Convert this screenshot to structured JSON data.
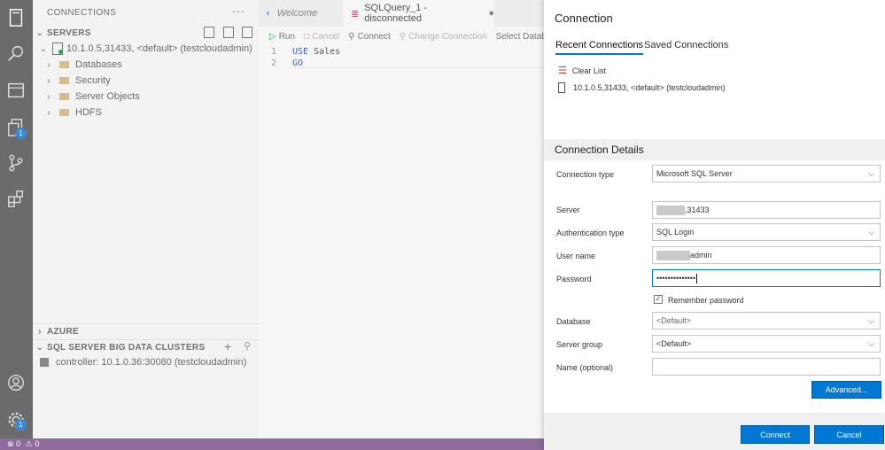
{
  "sidebar": {
    "title": "CONNECTIONS",
    "more": "···",
    "servers_header": "SERVERS",
    "server_node": "10.1.0.5,31433, <default> (testcloudadmin)",
    "children": [
      "Databases",
      "Security",
      "Server Objects",
      "HDFS"
    ],
    "azure_header": "AZURE",
    "bdc_header": "SQL SERVER BIG DATA CLUSTERS",
    "bdc_item": "controller: 10.1.0.36:30080 (testcloudadmin)"
  },
  "activity": {
    "explorer_badge": "1",
    "settings_badge": "1"
  },
  "editor": {
    "tab_welcome": "Welcome",
    "tab_query": "SQLQuery_1 - disconnected",
    "toolbar": {
      "run": "Run",
      "cancel": "Cancel",
      "connect": "Connect",
      "change_connection": "Change Connection",
      "select_database": "Select Database"
    },
    "lines": [
      {
        "num": "1",
        "kw": "USE",
        "text": " Sales"
      },
      {
        "num": "2",
        "kw": "GO",
        "text": ""
      }
    ]
  },
  "status": {
    "errors": "0",
    "warnings": "0"
  },
  "dialog": {
    "title": "Connection",
    "tabs": {
      "recent": "Recent Connections",
      "saved": "Saved Connections"
    },
    "clear_list": "Clear List",
    "recent_item": "10.1.0.5,31433, <default> (testcloudadmin)",
    "details_title": "Connection Details",
    "fields": {
      "connection_type": {
        "label": "Connection type",
        "value": "Microsoft SQL Server"
      },
      "server": {
        "label": "Server",
        "value": ",31433"
      },
      "auth_type": {
        "label": "Authentication type",
        "value": "SQL Login"
      },
      "user_name": {
        "label": "User name",
        "value": "admin"
      },
      "password": {
        "label": "Password",
        "value": "••••••••••••••"
      },
      "remember": {
        "label": "Remember password"
      },
      "database": {
        "label": "Database",
        "value": "<Default>"
      },
      "server_group": {
        "label": "Server group",
        "value": "<Default>"
      },
      "name": {
        "label": "Name (optional)",
        "value": ""
      }
    },
    "advanced": "Advanced...",
    "connect": "Connect",
    "cancel": "Cancel"
  },
  "colors": {
    "accent": "#0078d4",
    "status_bar": "#8e6a9d",
    "activity_bar": "#6b6b6b"
  }
}
